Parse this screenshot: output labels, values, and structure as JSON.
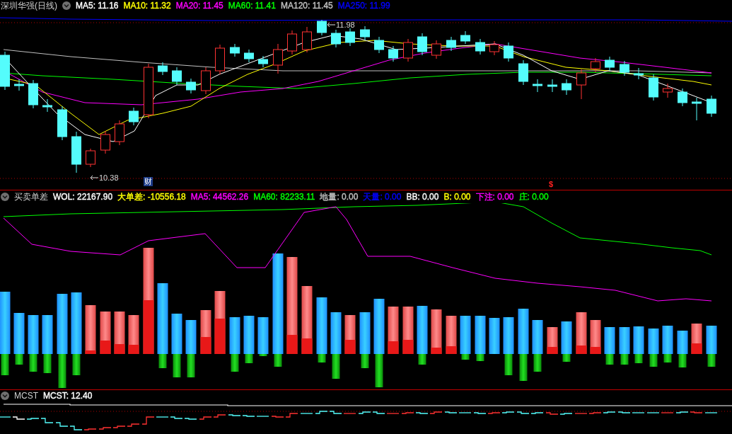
{
  "panels": [
    {
      "kind": "price",
      "title": "深圳华强(日线)",
      "indicators": [
        {
          "text": "MA5: 11.16",
          "color": "#ffffff"
        },
        {
          "text": "MA10: 11.32",
          "color": "#ffff00"
        },
        {
          "text": "MA20: 11.45",
          "color": "#ff00ff"
        },
        {
          "text": "MA60: 11.41",
          "color": "#00ff00"
        },
        {
          "text": "MA120: 11.45",
          "color": "#c0c0c0"
        },
        {
          "text": "MA250: 11.99",
          "color": "#0000ff"
        }
      ],
      "annotations": [
        {
          "kind": "high",
          "text": "11.98"
        },
        {
          "kind": "low",
          "text": "10.38"
        }
      ],
      "markers": [
        {
          "kind": "finance",
          "text": "财"
        },
        {
          "kind": "dividend",
          "text": "$"
        }
      ]
    },
    {
      "kind": "volume",
      "title": "买卖单差",
      "indicators": [
        {
          "text": "WOL: 22167.90",
          "color": "#ffffff"
        },
        {
          "text": "大单差: -10556.18",
          "color": "#ffff00"
        },
        {
          "text": "MA5: 44562.26",
          "color": "#ff00ff"
        },
        {
          "text": "MA60: 82233.11",
          "color": "#00ff00"
        },
        {
          "text": "地量: 0.00",
          "color": "#c0c0c0"
        },
        {
          "text": "天量: 0.00",
          "color": "#0000ff"
        },
        {
          "text": "BB: 0.00",
          "color": "#ffffff"
        },
        {
          "text": "B: 0.00",
          "color": "#ffff00"
        },
        {
          "text": "下注: 0.00",
          "color": "#ff00ff"
        },
        {
          "text": "庄: 0.00",
          "color": "#00ff00"
        }
      ]
    },
    {
      "kind": "cost",
      "title": "MCST",
      "indicators": [
        {
          "text": "MCST: 12.40",
          "color": "#ffffff"
        }
      ]
    }
  ]
}
